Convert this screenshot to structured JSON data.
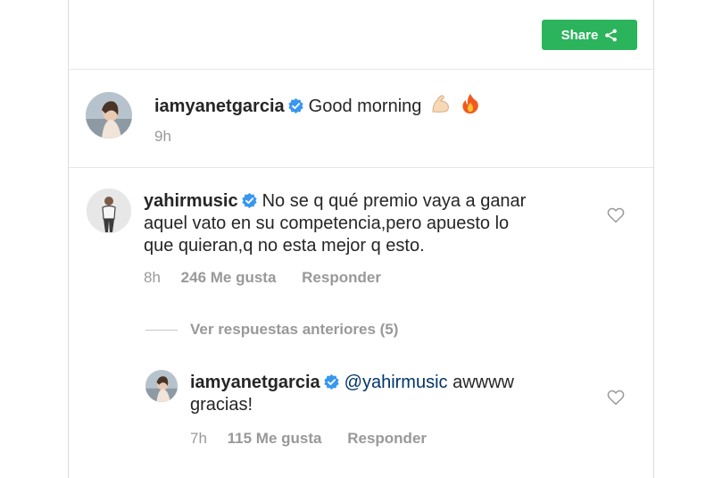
{
  "share": {
    "label": "Share"
  },
  "post": {
    "username": "iamyanetgarcia",
    "text": "Good morning",
    "time": "9h"
  },
  "comment1": {
    "username": "yahirmusic",
    "text_line1": "No se q qué premio vaya a ganar",
    "text_line2": "aquel vato en su competencia,pero apuesto lo",
    "text_line3": "que quieran,q no esta mejor q esto.",
    "time": "8h",
    "likes": "246 Me gusta",
    "reply": "Responder"
  },
  "view_replies": {
    "label": "Ver respuestas anteriores (5)"
  },
  "reply1": {
    "username": "iamyanetgarcia",
    "mention": "@yahirmusic",
    "text_line1": "awwww",
    "text_line2": "gracias!",
    "time": "7h",
    "likes": "115 Me gusta",
    "reply": "Responder"
  },
  "colors": {
    "share_green": "#2bb45c",
    "verified_blue": "#3897f0",
    "meta_gray": "#999999",
    "mention_blue": "#003569"
  },
  "icons": [
    "share-icon",
    "verified-badge-icon",
    "flexed-biceps-emoji",
    "fire-emoji",
    "heart-icon"
  ]
}
